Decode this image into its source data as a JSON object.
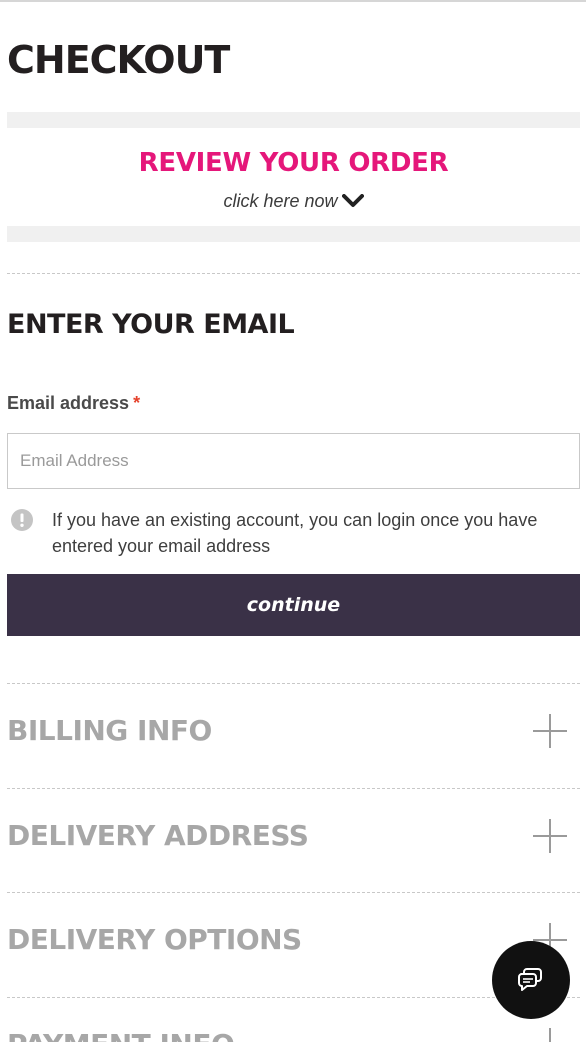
{
  "page": {
    "title": "CHECKOUT"
  },
  "review": {
    "title": "REVIEW YOUR ORDER",
    "link": "click here now"
  },
  "email_section": {
    "title": "ENTER YOUR EMAIL",
    "label": "Email address",
    "required_mark": "*",
    "placeholder": "Email Address",
    "value": "",
    "info_text": "If you have an existing account, you can login once you have entered your email address",
    "continue_label": "continue"
  },
  "accordion": [
    {
      "label": "BILLING INFO"
    },
    {
      "label": "DELIVERY ADDRESS"
    },
    {
      "label": "DELIVERY OPTIONS"
    },
    {
      "label": "PAYMENT INFO"
    }
  ],
  "colors": {
    "accent_pink": "#e5177a",
    "button_bg": "#3a3147",
    "muted_heading": "#a7a7a7",
    "dark_text": "#231f20"
  },
  "icons": {
    "review_toggle": "chevron-down-icon",
    "info": "info-icon",
    "expand": "plus-icon",
    "chat": "chat-icon"
  }
}
